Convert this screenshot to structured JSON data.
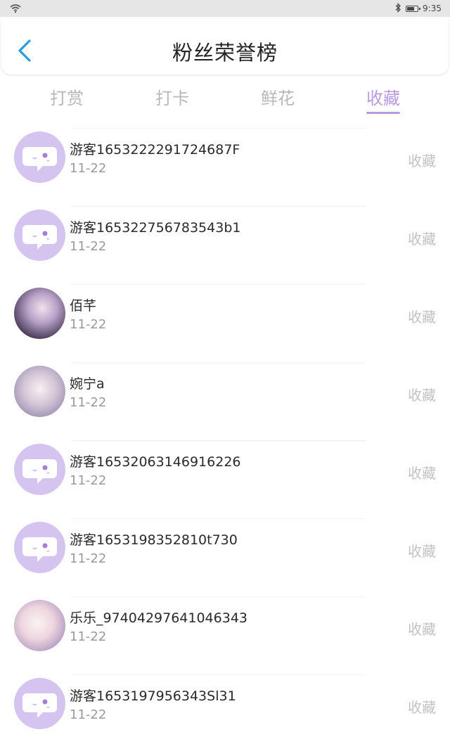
{
  "status_bar": {
    "time": "9:35",
    "battery_level": 0.8,
    "icons": [
      "wifi-icon",
      "bluetooth-icon",
      "battery-icon"
    ]
  },
  "header": {
    "title": "粉丝荣誉榜",
    "back_icon": "chevron-left-icon"
  },
  "tabs": [
    {
      "label": "打赏",
      "active": false
    },
    {
      "label": "打卡",
      "active": false
    },
    {
      "label": "鲜花",
      "active": false
    },
    {
      "label": "收藏",
      "active": true
    }
  ],
  "colors": {
    "accent": "#b99ae0",
    "back_icon": "#2b9be8",
    "guest_avatar_bg": "#d6c4f0",
    "inactive_text": "#b8b8b8"
  },
  "rows": [
    {
      "name": "游客1653222291724687F",
      "date": "11-22",
      "action": "收藏",
      "avatar": "guest"
    },
    {
      "name": "游客165322756783543b1",
      "date": "11-22",
      "action": "收藏",
      "avatar": "guest"
    },
    {
      "name": "佰芊",
      "date": "11-22",
      "action": "收藏",
      "avatar": "photo"
    },
    {
      "name": "婉宁a",
      "date": "11-22",
      "action": "收藏",
      "avatar": "photo"
    },
    {
      "name": "游客16532063146916226",
      "date": "11-22",
      "action": "收藏",
      "avatar": "guest"
    },
    {
      "name": "游客1653198352810t730",
      "date": "11-22",
      "action": "收藏",
      "avatar": "guest"
    },
    {
      "name": "乐乐_97404297641046343",
      "date": "11-22",
      "action": "收藏",
      "avatar": "photo"
    },
    {
      "name": "游客1653197956343Sl31",
      "date": "11-22",
      "action": "收藏",
      "avatar": "guest"
    }
  ]
}
